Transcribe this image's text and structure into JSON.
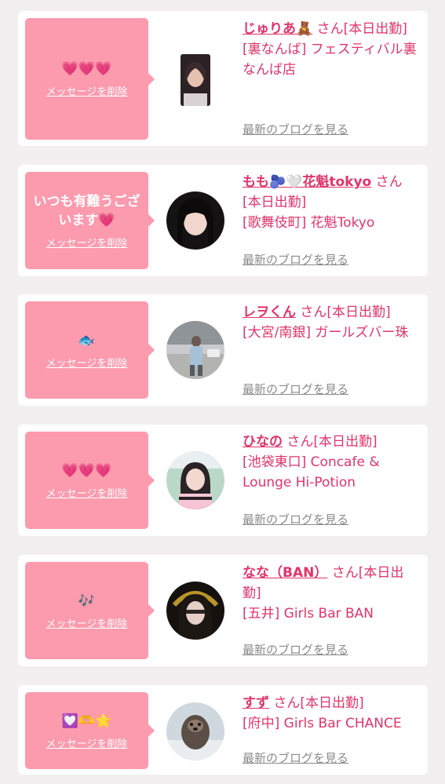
{
  "cards": [
    {
      "message": "💗💗💗",
      "delete_label": "メッセージを削除",
      "name": "じゅりあ🧸",
      "san": "さん",
      "status": "[本日出勤]",
      "shop": "[裏なんば] フェスティバル裏なんば店",
      "blog_label": "最新のブログを見る"
    },
    {
      "message": "いつも有難うございます💗",
      "delete_label": "メッセージを削除",
      "name": "もも🫐🤍花魁tokyo",
      "san": "さん",
      "status": "[本日出勤]",
      "shop": "[歌舞伎町] 花魁Tokyo",
      "blog_label": "最新のブログを見る"
    },
    {
      "message": "🐟",
      "delete_label": "メッセージを削除",
      "name": "レヲくん",
      "san": "さん",
      "status": "[本日出勤]",
      "shop": "[大宮/南銀] ガールズバー珠",
      "blog_label": "最新のブログを見る"
    },
    {
      "message": "💗💗💗",
      "delete_label": "メッセージを削除",
      "name": "ひなの",
      "san": "さん",
      "status": "[本日出勤]",
      "shop": "[池袋東口] Concafe & Lounge Hi-Potion",
      "blog_label": "最新のブログを見る"
    },
    {
      "message": "🎶",
      "delete_label": "メッセージを削除",
      "name": "なな（BAN）",
      "san": "さん",
      "status": "[本日出勤]",
      "shop": "[五井] Girls Bar BAN",
      "blog_label": "最新のブログを見る"
    },
    {
      "message": "💟🫶🌟",
      "delete_label": "メッセージを削除",
      "name": "すず",
      "san": "さん",
      "status": "[本日出勤]",
      "shop": "[府中] Girls Bar CHANCE",
      "blog_label": "最新のブログを見る"
    }
  ]
}
